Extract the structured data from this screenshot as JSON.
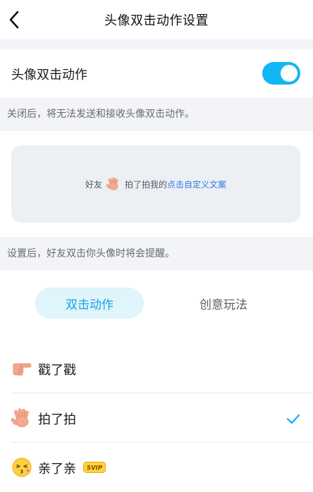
{
  "header": {
    "title": "头像双击动作设置",
    "back_icon": "chevron-left-icon"
  },
  "toggle_section": {
    "label": "头像双击动作",
    "enabled": true,
    "accent_color": "#12b6f2"
  },
  "hints": {
    "toggle_hint": "关闭后，将无法发送和接收头像双击动作。",
    "preview_hint": "设置后，好友双击你头像时将会提醒。"
  },
  "preview": {
    "friend": "好友",
    "action": "拍了拍我的",
    "custom_link": "点击自定义文案",
    "icon": "waving-hand-icon"
  },
  "tabs": [
    {
      "label": "双击动作",
      "active": true
    },
    {
      "label": "创意玩法",
      "active": false
    }
  ],
  "actions": [
    {
      "label": "戳了戳",
      "icon": "pointing-hand-icon",
      "selected": false
    },
    {
      "label": "拍了拍",
      "icon": "waving-hand-icon",
      "selected": true
    },
    {
      "label": "亲了亲",
      "icon": "kissing-face-icon",
      "selected": false,
      "badge": "SVIP"
    }
  ]
}
